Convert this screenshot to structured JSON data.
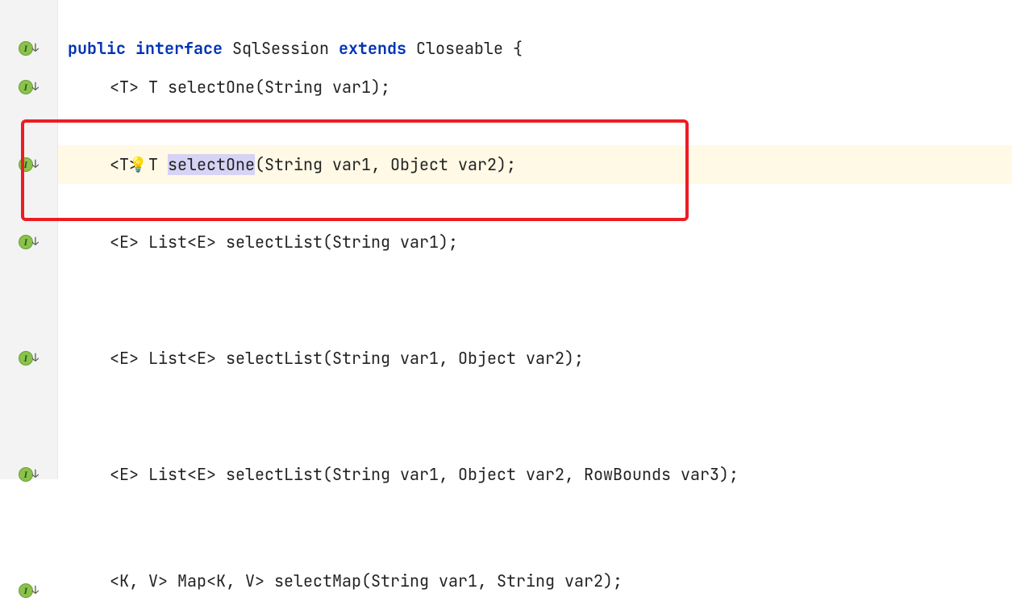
{
  "keywords": {
    "public": "public",
    "interface": "interface",
    "extends": "extends"
  },
  "decl": {
    "typename": " SqlSession ",
    "supertype": " Closeable {"
  },
  "lines": {
    "l1": "<T> T selectOne(String var1);",
    "l2_a": "<T> T ",
    "l2_sel": "selectOne",
    "l2_b": "(String var1, Object var2);",
    "l3": "<E> List<E> selectList(String var1);",
    "l4": "<E> List<E> selectList(String var1, Object var2);",
    "l5": "<E> List<E> selectList(String var1, Object var2, RowBounds var3);",
    "l6": "<K, V> Map<K, V> selectMap(String var1, String var2);"
  },
  "icons": {
    "impl": "I",
    "bulb": "💡",
    "arrow": "↓"
  }
}
